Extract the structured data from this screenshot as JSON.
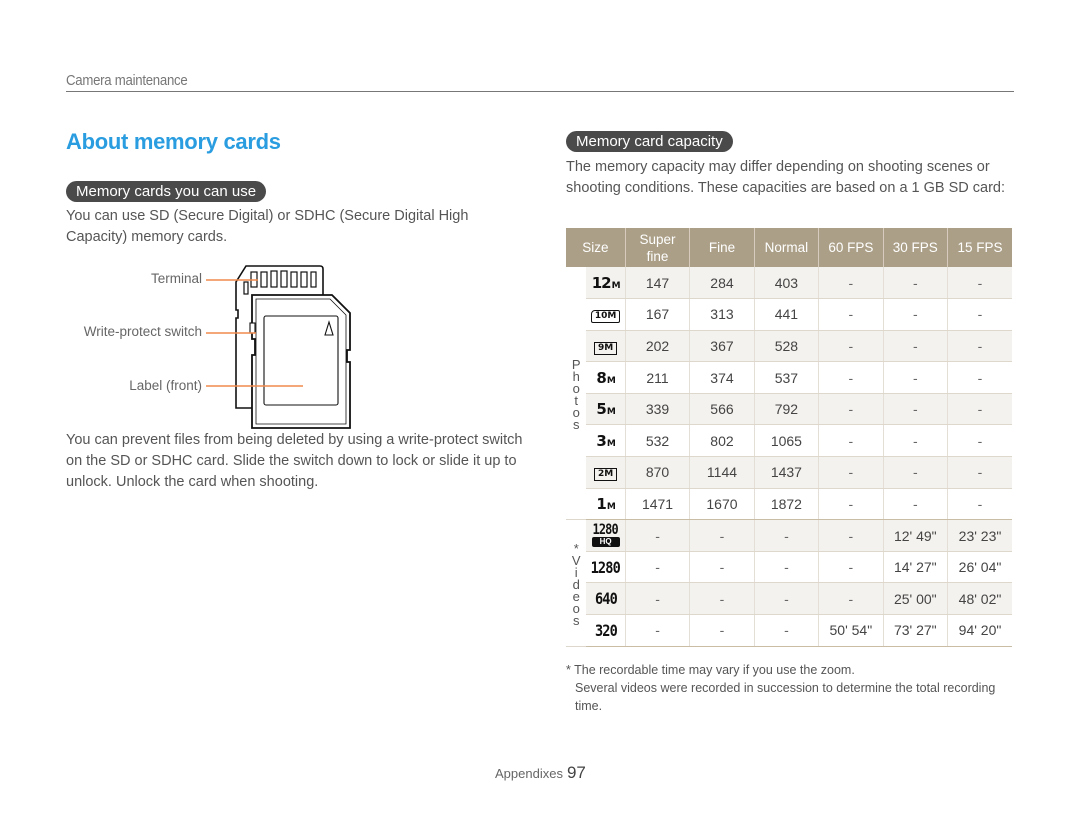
{
  "header": {
    "section": "Camera maintenance"
  },
  "page_title": "About memory cards",
  "left": {
    "pill": "Memory cards you can use",
    "intro": "You can use SD (Secure Digital) or SDHC (Secure Digital High Capacity) memory cards.",
    "diagram": {
      "labels": [
        "Terminal",
        "Write-protect switch",
        "Label (front)"
      ],
      "accent_color": "#f08a4b"
    },
    "body": "You can prevent files from being deleted by using a write-protect switch on the SD or SDHC card. Slide the switch down to lock or slide it up to unlock. Unlock the card when shooting."
  },
  "right": {
    "pill": "Memory card capacity",
    "intro": "The memory capacity may differ depending on shooting scenes or shooting conditions. These capacities are based on a 1 GB SD card:",
    "table": {
      "header_color": "#ab9f87",
      "columns": [
        "Size",
        "Super fine",
        "Fine",
        "Normal",
        "60 FPS",
        "30 FPS",
        "15 FPS"
      ],
      "groups": [
        {
          "label": "Photos",
          "rows": [
            {
              "size_icon": "12M",
              "values": [
                "147",
                "284",
                "403",
                "-",
                "-",
                "-"
              ]
            },
            {
              "size_icon": "10M wide",
              "values": [
                "167",
                "313",
                "441",
                "-",
                "-",
                "-"
              ]
            },
            {
              "size_icon": "9M panorama",
              "values": [
                "202",
                "367",
                "528",
                "-",
                "-",
                "-"
              ]
            },
            {
              "size_icon": "8M",
              "values": [
                "211",
                "374",
                "537",
                "-",
                "-",
                "-"
              ]
            },
            {
              "size_icon": "5M",
              "values": [
                "339",
                "566",
                "792",
                "-",
                "-",
                "-"
              ]
            },
            {
              "size_icon": "3M",
              "values": [
                "532",
                "802",
                "1065",
                "-",
                "-",
                "-"
              ]
            },
            {
              "size_icon": "2M panorama",
              "values": [
                "870",
                "1144",
                "1437",
                "-",
                "-",
                "-"
              ]
            },
            {
              "size_icon": "1M",
              "values": [
                "1471",
                "1670",
                "1872",
                "-",
                "-",
                "-"
              ]
            }
          ]
        },
        {
          "label": "*Videos",
          "rows": [
            {
              "size_icon": "1280 HQ",
              "values": [
                "-",
                "-",
                "-",
                "-",
                "12' 49\"",
                "23' 23\""
              ]
            },
            {
              "size_icon": "1280",
              "values": [
                "-",
                "-",
                "-",
                "-",
                "14' 27\"",
                "26' 04\""
              ]
            },
            {
              "size_icon": "640",
              "values": [
                "-",
                "-",
                "-",
                "-",
                "25' 00\"",
                "48' 02\""
              ]
            },
            {
              "size_icon": "320",
              "values": [
                "-",
                "-",
                "-",
                "50' 54\"",
                "73' 27\"",
                "94' 20\""
              ]
            }
          ]
        }
      ],
      "icon_text": {
        "12M": "12",
        "10M": "10M",
        "9M": "9M",
        "8M": "8",
        "5M": "5",
        "3M": "3",
        "2M": "2M",
        "1M": "1",
        "M": "M",
        "v1280": "1280",
        "HQ": "HQ",
        "v640": "640",
        "v320": "320"
      }
    },
    "footnote": {
      "line1": "* The recordable time may vary if you use the zoom.",
      "line2": "Several videos were recorded in succession to determine the total recording time."
    }
  },
  "footer": {
    "section": "Appendixes",
    "page_number": "97"
  }
}
